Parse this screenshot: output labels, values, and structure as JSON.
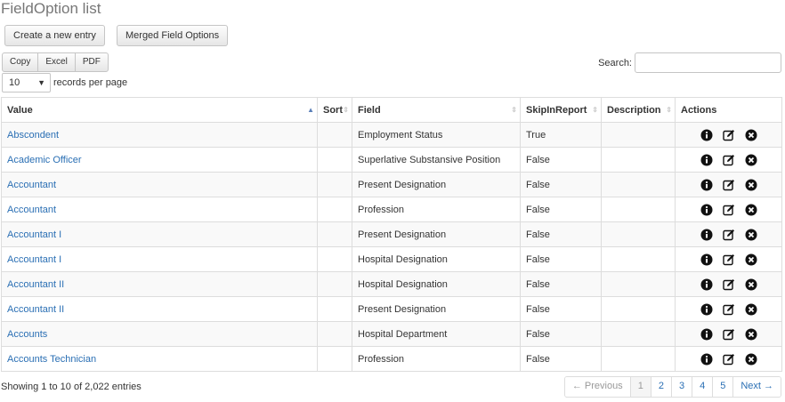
{
  "page": {
    "title": "FieldOption list"
  },
  "toolbar": {
    "create_label": "Create a new entry",
    "merged_label": "Merged Field Options"
  },
  "export": {
    "copy": "Copy",
    "excel": "Excel",
    "pdf": "PDF"
  },
  "length": {
    "selected": "10",
    "label": "records per page"
  },
  "search": {
    "label": "Search:",
    "placeholder": "",
    "value": ""
  },
  "table": {
    "columns": [
      "Value",
      "Sort",
      "Field",
      "SkipInReport",
      "Description",
      "Actions"
    ],
    "sort_column": "Value",
    "rows": [
      {
        "value": "Abscondent",
        "sort": "",
        "field": "Employment Status",
        "skip": "True",
        "description": ""
      },
      {
        "value": "Academic Officer",
        "sort": "",
        "field": "Superlative Substansive Position",
        "skip": "False",
        "description": ""
      },
      {
        "value": "Accountant",
        "sort": "",
        "field": "Present Designation",
        "skip": "False",
        "description": ""
      },
      {
        "value": "Accountant",
        "sort": "",
        "field": "Profession",
        "skip": "False",
        "description": ""
      },
      {
        "value": "Accountant I",
        "sort": "",
        "field": "Present Designation",
        "skip": "False",
        "description": ""
      },
      {
        "value": "Accountant I",
        "sort": "",
        "field": "Hospital Designation",
        "skip": "False",
        "description": ""
      },
      {
        "value": "Accountant II",
        "sort": "",
        "field": "Hospital Designation",
        "skip": "False",
        "description": ""
      },
      {
        "value": "Accountant II",
        "sort": "",
        "field": "Present Designation",
        "skip": "False",
        "description": ""
      },
      {
        "value": "Accounts",
        "sort": "",
        "field": "Hospital Department",
        "skip": "False",
        "description": ""
      },
      {
        "value": "Accounts Technician",
        "sort": "",
        "field": "Profession",
        "skip": "False",
        "description": ""
      }
    ],
    "actions": [
      "info-icon",
      "edit-icon",
      "delete-icon"
    ]
  },
  "footer": {
    "info": "Showing 1 to 10 of 2,022 entries"
  },
  "pagination": {
    "previous": "← Previous",
    "pages": [
      "1",
      "2",
      "3",
      "4",
      "5"
    ],
    "current": "1",
    "next": "Next →"
  },
  "colors": {
    "link": "#2a6fb4",
    "border": "#dddddd",
    "title": "#777777"
  }
}
